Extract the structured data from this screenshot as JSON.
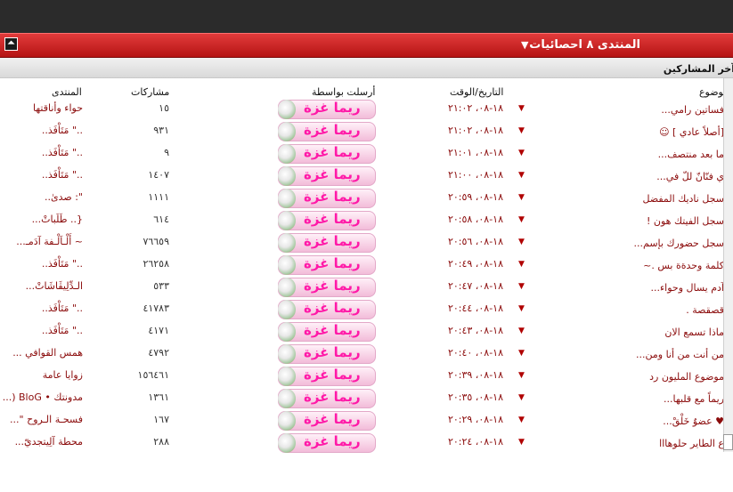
{
  "forum_header": {
    "title": "المنتدى ٨ احصائيات",
    "collapse_icon": "chevrons-up-icon",
    "menu_icon": "triangle-down-icon"
  },
  "section_title": "آخر المشاركين",
  "columns": {
    "topic": "الموضوع",
    "datetime": "التاريخ/الوقت",
    "posted_by": "أرسلت بواسطة",
    "posts": "مشاركات",
    "forum": "المنتدى"
  },
  "colors": {
    "accent_red": "#c41b1b",
    "link_red": "#8b0b0b",
    "signature_pink": "#ff1aa8"
  },
  "rows": [
    {
      "topic": "فساتين رامي...",
      "date": "١٨-٠٨، ٢١:٠٢",
      "author": "ريما غزة",
      "posts": "١٥",
      "forum": "حواء وأناقتها"
    },
    {
      "topic": "[أصلاً عادي ] ☺",
      "date": "١٨-٠٨، ٢١:٠٢",
      "author": "ريما غزة",
      "posts": "٩٣١",
      "forum": "..\" مَتَاْفَذ.."
    },
    {
      "topic": "ما بعد منتصف...",
      "date": "١٨-٠٨، ٢١:٠١",
      "author": "ريما غزة",
      "posts": "٩",
      "forum": "..\" مَتَاْفَذ.."
    },
    {
      "topic": "ي فنّانّ للّ في...",
      "date": "١٨-٠٨، ٢١:٠٠",
      "author": "ريما غزة",
      "posts": "١٤٠٧",
      "forum": "..\" مَتَاْفَذ.."
    },
    {
      "topic": "سجل ناديك المفضل",
      "date": "١٨-٠٨، ٢٠:٥٩",
      "author": "ريما غزة",
      "posts": "١١١١",
      "forum": "\": صدىٰ.."
    },
    {
      "topic": "سجل الفيتك هون !",
      "date": "١٨-٠٨، ٢٠:٥٨",
      "author": "ريما غزة",
      "posts": "٦١٤",
      "forum": "{.. طَلَباتْ..."
    },
    {
      "topic": "سجل حضورك بإسم...",
      "date": "١٨-٠٨، ٢٠:٥٦",
      "author": "ريما غزة",
      "posts": "٧٦٦٥٩",
      "forum": "~ أَلْـاَلْـفة آدَمـ..."
    },
    {
      "topic": "كلمة وحدةة بس .~",
      "date": "١٨-٠٨، ٢٠:٤٩",
      "author": "ريما غزة",
      "posts": "٢٦٢٥٨",
      "forum": "..\" مَتَاْفَذ.."
    },
    {
      "topic": "آدم يسال وحواء...",
      "date": "١٨-٠٨، ٢٠:٤٧",
      "author": "ريما غزة",
      "posts": "٥٣٣",
      "forum": "الـدِّلِيڤَاشَاتْ..."
    },
    {
      "topic": "قصقصة .",
      "date": "١٨-٠٨، ٢٠:٤٤",
      "author": "ريما غزة",
      "posts": "٤١٧٨٣",
      "forum": "..\" مَتَاْفَذ.."
    },
    {
      "topic": "ماذا تسمع الان",
      "date": "١٨-٠٨، ٢٠:٤٣",
      "author": "ريما غزة",
      "posts": "٤١٧١",
      "forum": "..\" مَتَاْفَذ.."
    },
    {
      "topic": "من أنت من أنا ومن...",
      "date": "١٨-٠٨، ٢٠:٤٠",
      "author": "ريما غزة",
      "posts": "٤٧٩٢",
      "forum": "همس القوافي ..."
    },
    {
      "topic": "موضوع المليون رد",
      "date": "١٨-٠٨، ٢٠:٣٩",
      "author": "ريما غزة",
      "posts": "١٥٦٤٦١",
      "forum": "زوايا عامة"
    },
    {
      "topic": "ريماً مع قلبها...",
      "date": "١٨-٠٨، ٢٠:٣٥",
      "author": "ريما غزة",
      "posts": "١٣٦١",
      "forum": "مدونتك • BloG (..."
    },
    {
      "topic": "♥ عضوٌ خَلْقْ...",
      "date": "١٨-٠٨، ٢٠:٢٩",
      "author": "ريما غزة",
      "posts": "١٦٧",
      "forum": "فسحـة الـروح \"..."
    },
    {
      "topic": "ع الطاير حلوهااا",
      "date": "١٨-٠٨، ٢٠:٢٤",
      "author": "ريما غزة",
      "posts": "٢٨٨",
      "forum": "محطة آلِيتجديّ..."
    }
  ]
}
